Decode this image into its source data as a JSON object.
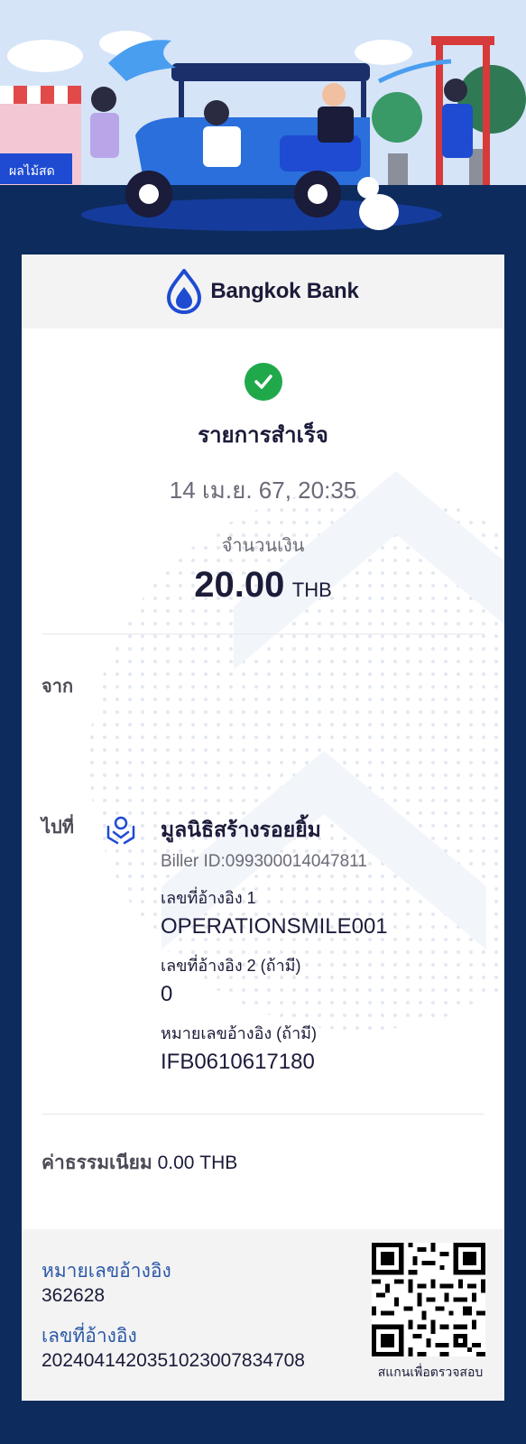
{
  "brand": {
    "name": "Bangkok Bank",
    "color": "#1e4bd2"
  },
  "status": {
    "title": "รายการสำเร็จ",
    "icon": "check-circle-icon",
    "color": "#1fa94b"
  },
  "datetime": "14 เม.ย. 67, 20:35",
  "amount": {
    "label": "จำนวนเงิน",
    "value": "20.00",
    "currency": "THB"
  },
  "from": {
    "label": "จาก"
  },
  "to": {
    "label": "ไปที่",
    "icon": "charity-hands-icon",
    "name": "มูลนิธิสร้างรอยยิ้ม",
    "biller_id": "Biller ID:099300014047811",
    "ref1_label": "เลขที่อ้างอิง 1",
    "ref1_value": "OPERATIONSMILE001",
    "ref2_label": "เลขที่อ้างอิง 2 (ถ้ามี)",
    "ref2_value": "0",
    "ref3_label": "หมายเลขอ้างอิง (ถ้ามี)",
    "ref3_value": "IFB0610617180"
  },
  "fee": {
    "label": "ค่าธรรมเนียม",
    "value": "0.00 THB"
  },
  "footer": {
    "ref_no_label": "หมายเลขอ้างอิง",
    "ref_no_value": "362628",
    "txn_ref_label": "เลขที่อ้างอิง",
    "txn_ref_value": "202404142035102300783470​8",
    "qr_caption": "สแกนเพื่อตรวจสอบ"
  },
  "banner": {
    "shop_sign": "ผลไม้สด"
  }
}
